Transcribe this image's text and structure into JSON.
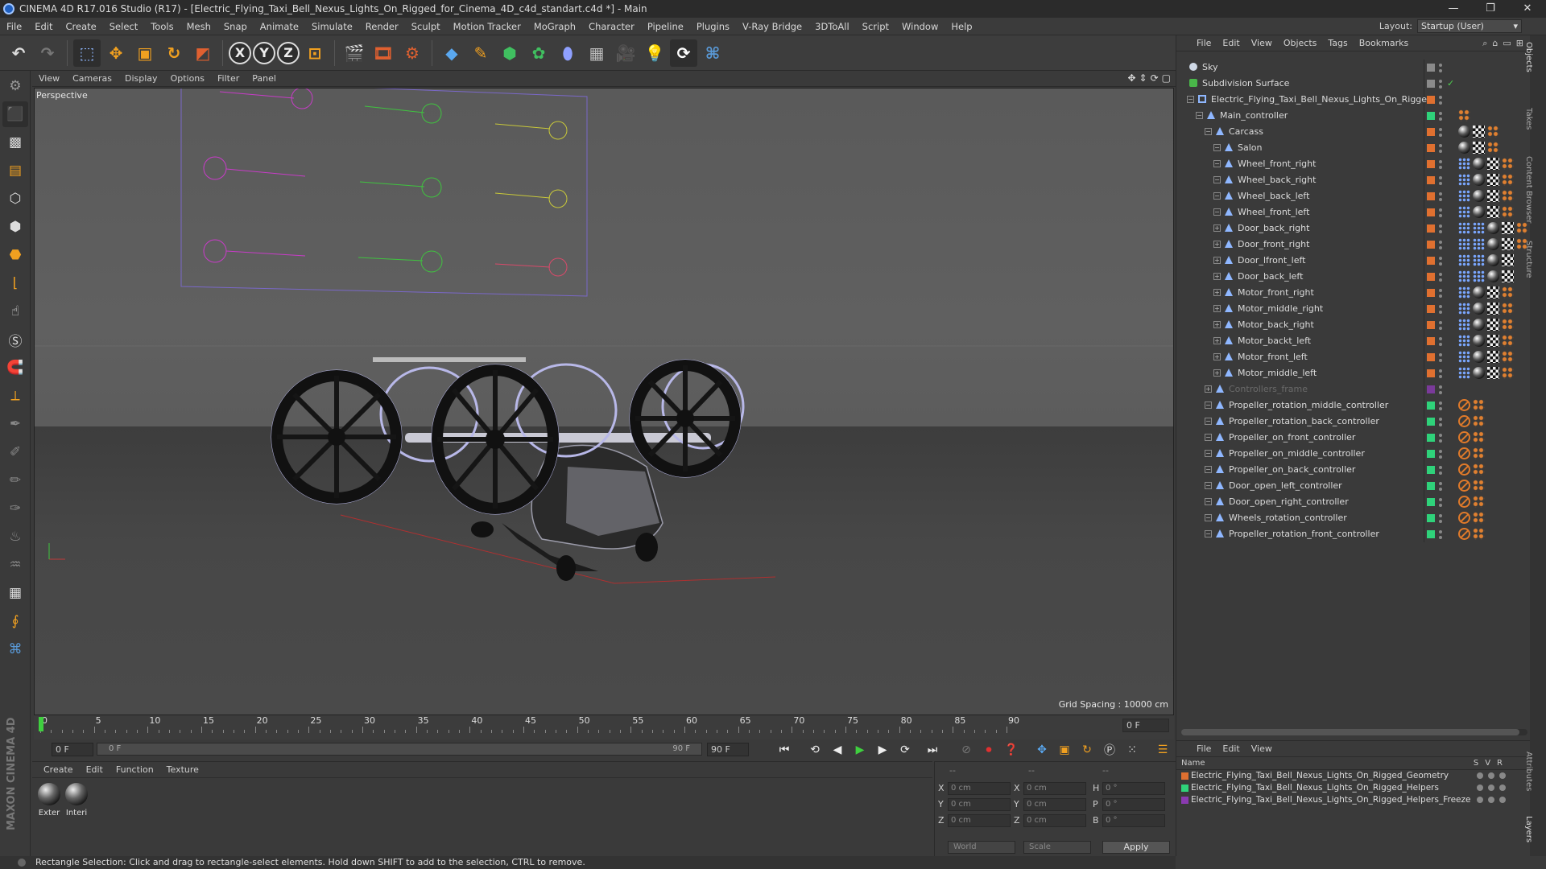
{
  "window": {
    "title": "CINEMA 4D R17.016 Studio (R17) - [Electric_Flying_Taxi_Bell_Nexus_Lights_On_Rigged_for_Cinema_4D_c4d_standart.c4d *] - Main",
    "controls": [
      "—",
      "❐",
      "✕"
    ]
  },
  "menubar": {
    "items": [
      "File",
      "Edit",
      "Create",
      "Select",
      "Tools",
      "Mesh",
      "Snap",
      "Animate",
      "Simulate",
      "Render",
      "Sculpt",
      "Motion Tracker",
      "MoGraph",
      "Character",
      "Pipeline",
      "Plugins",
      "V-Ray Bridge",
      "3DToAll",
      "Script",
      "Window",
      "Help"
    ],
    "layout_label": "Layout:",
    "layout_value": "Startup (User)"
  },
  "toolbar": {
    "icons": [
      "undo-icon",
      "redo-icon",
      "rectangle-select-icon",
      "move-icon",
      "scale-icon",
      "rotate-icon",
      "live-select-icon",
      "x-axis-icon",
      "y-axis-icon",
      "z-axis-icon",
      "coordinate-system-icon",
      "render-view-icon",
      "render-picture-viewer-icon",
      "edit-render-settings-icon",
      "cube-icon",
      "pen-icon",
      "subdivision-icon",
      "array-icon",
      "deformer-icon",
      "floor-icon",
      "camera-icon",
      "light-icon",
      "vray-icon",
      "python-icon"
    ],
    "axis_labels": [
      "X",
      "Y",
      "Z"
    ]
  },
  "viewport": {
    "menu": [
      "View",
      "Cameras",
      "Display",
      "Options",
      "Filter",
      "Panel"
    ],
    "label": "Perspective",
    "grid_spacing": "Grid Spacing : 10000 cm"
  },
  "controller_labels": {
    "colors": {
      "magenta": "#d23cd2",
      "green": "#3fc43f",
      "yellow": "#c8c83a",
      "pink": "#d84a6a"
    }
  },
  "timeline": {
    "ticks": [
      "0",
      "5",
      "10",
      "15",
      "20",
      "25",
      "30",
      "35",
      "40",
      "45",
      "50",
      "55",
      "60",
      "65",
      "70",
      "75",
      "80",
      "85",
      "90"
    ],
    "end_frame": "0 F"
  },
  "transport": {
    "current_frame": "0 F",
    "slider_start": "0 F",
    "slider_end": "90 F",
    "max_frame": "90 F"
  },
  "material_panel": {
    "menu": [
      "Create",
      "Edit",
      "Function",
      "Texture"
    ],
    "materials": [
      "Exter",
      "Interi"
    ]
  },
  "coordinates": {
    "header_left": "--",
    "header_mid": "--",
    "header_right": "--",
    "rows": [
      {
        "axis": "X",
        "pos": "0 cm",
        "axis2": "X",
        "size": "0 cm",
        "axis3": "H",
        "rot": "0 °"
      },
      {
        "axis": "Y",
        "pos": "0 cm",
        "axis2": "Y",
        "size": "0 cm",
        "axis3": "P",
        "rot": "0 °"
      },
      {
        "axis": "Z",
        "pos": "0 cm",
        "axis2": "Z",
        "size": "0 cm",
        "axis3": "B",
        "rot": "0 °"
      }
    ],
    "space": "World",
    "mode": "Scale",
    "apply": "Apply"
  },
  "status": "Rectangle Selection: Click and drag to rectangle-select elements. Hold down SHIFT to add to the selection, CTRL to remove.",
  "maxon_logo": "MAXON CINEMA 4D",
  "object_manager": {
    "menu": [
      "File",
      "Edit",
      "View",
      "Objects",
      "Tags",
      "Bookmarks"
    ],
    "objects": [
      {
        "name": "Sky",
        "depth": 0,
        "icon": "circle",
        "color": "#8a8a8a",
        "tags": []
      },
      {
        "name": "Subdivision Surface",
        "depth": 0,
        "icon": "sub",
        "color": "#8a8a8a",
        "tags": [],
        "check": "✓"
      },
      {
        "name": "Electric_Flying_Taxi_Bell_Nexus_Lights_On_Rigged",
        "depth": 1,
        "icon": "null",
        "color": "#e07030",
        "tags": []
      },
      {
        "name": "Main_controller",
        "depth": 2,
        "icon": "tri",
        "color": "#2fd27a",
        "tags": [
          "dots"
        ]
      },
      {
        "name": "Carcass",
        "depth": 3,
        "icon": "tri",
        "color": "#e07030",
        "tags": [
          "mat",
          "check",
          "dots"
        ]
      },
      {
        "name": "Salon",
        "depth": 4,
        "icon": "tri",
        "color": "#e07030",
        "tags": [
          "mat",
          "check",
          "dots"
        ]
      },
      {
        "name": "Wheel_front_right",
        "depth": 4,
        "icon": "tri",
        "color": "#e07030",
        "tags": [
          "dotted",
          "mat",
          "check",
          "dots"
        ]
      },
      {
        "name": "Wheel_back_right",
        "depth": 4,
        "icon": "tri",
        "color": "#e07030",
        "tags": [
          "dotted",
          "mat",
          "check",
          "dots"
        ]
      },
      {
        "name": "Wheel_back_left",
        "depth": 4,
        "icon": "tri",
        "color": "#e07030",
        "tags": [
          "dotted",
          "mat",
          "check",
          "dots"
        ]
      },
      {
        "name": "Wheel_front_left",
        "depth": 4,
        "icon": "tri",
        "color": "#e07030",
        "tags": [
          "dotted",
          "mat",
          "check",
          "dots"
        ]
      },
      {
        "name": "Door_back_right",
        "depth": 4,
        "icon": "tri",
        "color": "#e07030",
        "tags": [
          "dotted",
          "dotted",
          "mat",
          "check",
          "dots"
        ],
        "expander": "+"
      },
      {
        "name": "Door_front_right",
        "depth": 4,
        "icon": "tri",
        "color": "#e07030",
        "tags": [
          "dotted",
          "dotted",
          "mat",
          "check",
          "dots"
        ],
        "expander": "+"
      },
      {
        "name": "Door_lfront_left",
        "depth": 4,
        "icon": "tri",
        "color": "#e07030",
        "tags": [
          "dotted",
          "dotted",
          "mat",
          "check"
        ],
        "expander": "+"
      },
      {
        "name": "Door_back_left",
        "depth": 4,
        "icon": "tri",
        "color": "#e07030",
        "tags": [
          "dotted",
          "dotted",
          "mat",
          "check"
        ],
        "expander": "+"
      },
      {
        "name": "Motor_front_right",
        "depth": 4,
        "icon": "tri",
        "color": "#e07030",
        "tags": [
          "dotted",
          "mat",
          "check",
          "dots"
        ],
        "expander": "+"
      },
      {
        "name": "Motor_middle_right",
        "depth": 4,
        "icon": "tri",
        "color": "#e07030",
        "tags": [
          "dotted",
          "mat",
          "check",
          "dots"
        ],
        "expander": "+"
      },
      {
        "name": "Motor_back_right",
        "depth": 4,
        "icon": "tri",
        "color": "#e07030",
        "tags": [
          "dotted",
          "mat",
          "check",
          "dots"
        ],
        "expander": "+"
      },
      {
        "name": "Motor_backt_left",
        "depth": 4,
        "icon": "tri",
        "color": "#e07030",
        "tags": [
          "dotted",
          "mat",
          "check",
          "dots"
        ],
        "expander": "+"
      },
      {
        "name": "Motor_front_left",
        "depth": 4,
        "icon": "tri",
        "color": "#e07030",
        "tags": [
          "dotted",
          "mat",
          "check",
          "dots"
        ],
        "expander": "+"
      },
      {
        "name": "Motor_middle_left",
        "depth": 4,
        "icon": "tri",
        "color": "#e07030",
        "tags": [
          "dotted",
          "mat",
          "check",
          "dots"
        ],
        "expander": "+"
      },
      {
        "name": "Controllers_frame",
        "depth": 3,
        "icon": "tri",
        "color": "#7a3a9a",
        "tags": [],
        "dim": true,
        "expander": "+"
      },
      {
        "name": "Propeller_rotation_middle_controller",
        "depth": 3,
        "icon": "tri",
        "color": "#2fd27a",
        "tags": [
          "nope",
          "dots"
        ]
      },
      {
        "name": "Propeller_rotation_back_controller",
        "depth": 3,
        "icon": "tri",
        "color": "#2fd27a",
        "tags": [
          "nope",
          "dots"
        ]
      },
      {
        "name": "Propeller_on_front_controller",
        "depth": 3,
        "icon": "tri",
        "color": "#2fd27a",
        "tags": [
          "nope",
          "dots"
        ]
      },
      {
        "name": "Propeller_on_middle_controller",
        "depth": 3,
        "icon": "tri",
        "color": "#2fd27a",
        "tags": [
          "nope",
          "dots"
        ]
      },
      {
        "name": "Propeller_on_back_controller",
        "depth": 3,
        "icon": "tri",
        "color": "#2fd27a",
        "tags": [
          "nope",
          "dots"
        ]
      },
      {
        "name": "Door_open_left_controller",
        "depth": 3,
        "icon": "tri",
        "color": "#2fd27a",
        "tags": [
          "nope",
          "dots"
        ]
      },
      {
        "name": "Door_open_right_controller",
        "depth": 3,
        "icon": "tri",
        "color": "#2fd27a",
        "tags": [
          "nope",
          "dots"
        ]
      },
      {
        "name": "Wheels_rotation_controller",
        "depth": 3,
        "icon": "tri",
        "color": "#2fd27a",
        "tags": [
          "nope",
          "dots"
        ]
      },
      {
        "name": "Propeller_rotation_front_controller",
        "depth": 3,
        "icon": "tri",
        "color": "#2fd27a",
        "tags": [
          "nope",
          "dots"
        ]
      }
    ]
  },
  "layer_manager": {
    "menu": [
      "File",
      "Edit",
      "View"
    ],
    "header": "Name",
    "cols": [
      "S",
      "V",
      "R"
    ],
    "layers": [
      {
        "name": "Electric_Flying_Taxi_Bell_Nexus_Lights_On_Rigged_Geometry",
        "color": "#e07030"
      },
      {
        "name": "Electric_Flying_Taxi_Bell_Nexus_Lights_On_Rigged_Helpers",
        "color": "#2fd27a"
      },
      {
        "name": "Electric_Flying_Taxi_Bell_Nexus_Lights_On_Rigged_Helpers_Freeze",
        "color": "#8a3ab0"
      }
    ]
  },
  "side_tabs": [
    "Objects",
    "Takes",
    "Content Browser",
    "Structure",
    "Attributes",
    "Layers"
  ]
}
